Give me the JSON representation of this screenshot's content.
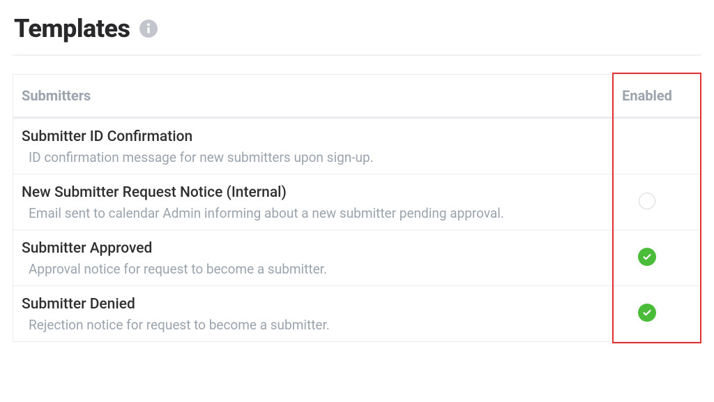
{
  "header": {
    "title": "Templates"
  },
  "table": {
    "columns": {
      "main": "Submitters",
      "enabled": "Enabled"
    },
    "rows": [
      {
        "title": "Submitter ID Confirmation",
        "desc": "ID confirmation message for new submitters upon sign-up.",
        "status": "none"
      },
      {
        "title": "New Submitter Request Notice (Internal)",
        "desc": "Email sent to calendar Admin informing about a new submitter pending approval.",
        "status": "empty"
      },
      {
        "title": "Submitter Approved",
        "desc": "Approval notice for request to become a submitter.",
        "status": "enabled"
      },
      {
        "title": "Submitter Denied",
        "desc": "Rejection notice for request to become a submitter.",
        "status": "enabled"
      }
    ]
  }
}
